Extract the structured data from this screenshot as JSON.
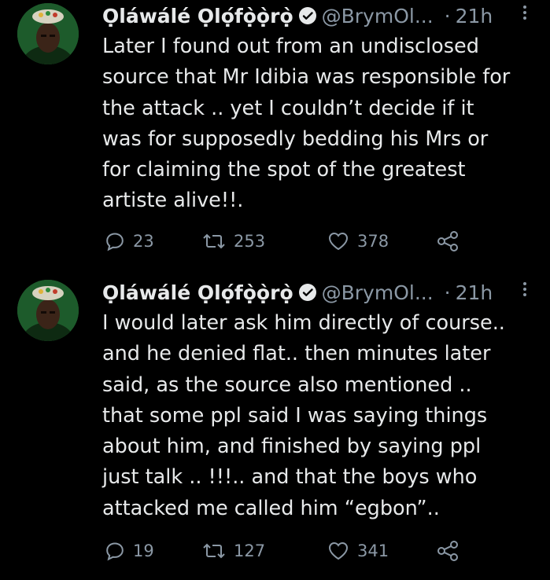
{
  "tweets": [
    {
      "author_name": "Ọláwálé Ọlọ́fọ̀ọ̀rọ̀",
      "handle": "@BrymOl...",
      "time_sep": "·",
      "time": "21h",
      "text": "Later I found out from an undisclosed\nsource that Mr Idibia was responsible for\nthe attack .. yet I couldn’t decide if it\nwas for supposedly bedding his Mrs or\nfor claiming the spot of the greatest\nartiste alive!!.",
      "replies": "23",
      "retweets": "253",
      "likes": "378"
    },
    {
      "author_name": "Ọláwálé Ọlọ́fọ̀ọ̀rọ̀",
      "handle": "@BrymOl...",
      "time_sep": "·",
      "time": "21h",
      "text": "I would later ask him directly of course..\nand he denied flat.. then minutes later\nsaid, as the source also mentioned ..\nthat some ppl said I was saying things\nabout him, and finished by saying ppl\njust talk .. !!!.. and that the boys who\nattacked me called him “egbon”..",
      "replies": "19",
      "retweets": "127",
      "likes": "341"
    }
  ],
  "icons": {
    "verified": "verified-badge-icon",
    "more": "more-options-icon",
    "reply": "reply-icon",
    "retweet": "retweet-icon",
    "like": "heart-icon",
    "share": "share-icon"
  },
  "colors": {
    "background": "#000000",
    "text": "#e7e9ea",
    "muted": "#8b98a5"
  }
}
